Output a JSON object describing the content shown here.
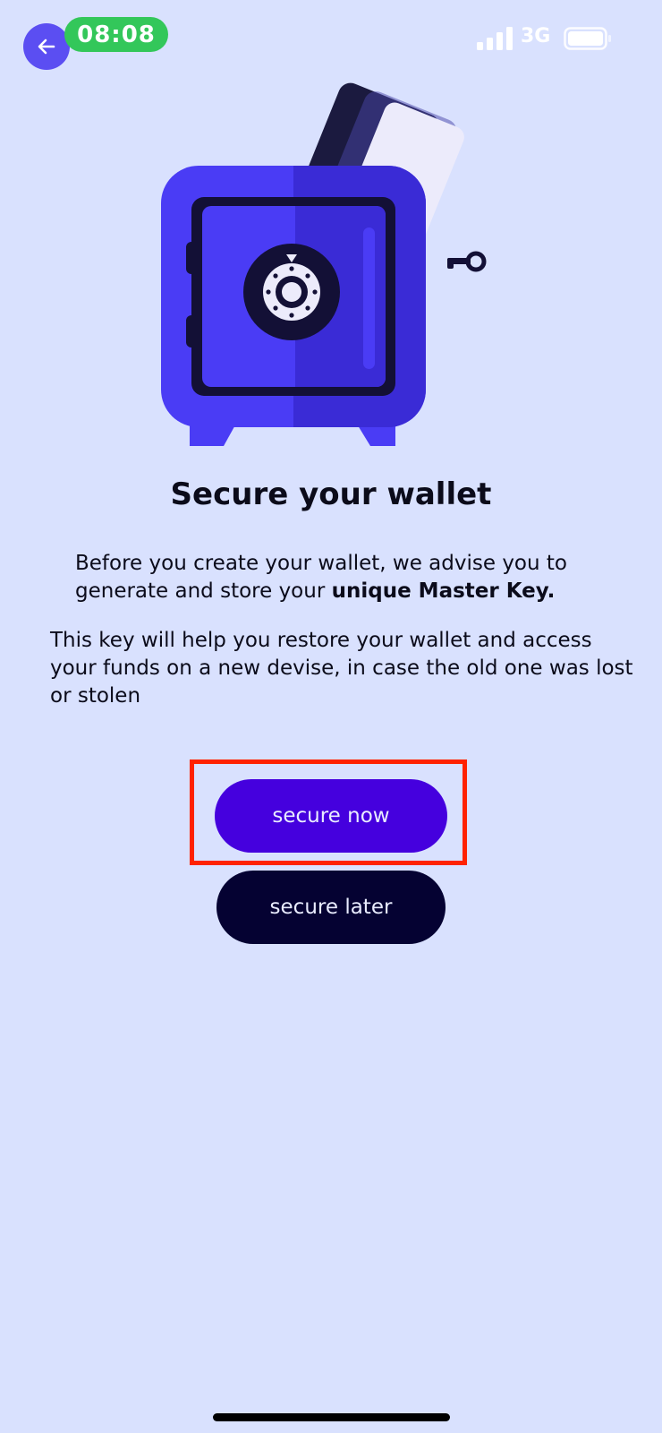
{
  "status_bar": {
    "time": "08:08",
    "network": "3G"
  },
  "main": {
    "title": "Secure your wallet",
    "intro_text": "Before you create your wallet, we advise you to generate and store your ",
    "intro_emphasis": "unique Master Key.",
    "body_text": "This key will help you restore your wallet and access your funds on a new devise, in case the old one was lost or stolen"
  },
  "actions": {
    "secure_now_label": "secure now",
    "secure_later_label": "secure later"
  },
  "colors": {
    "background": "#d9e1fe",
    "primary_button": "#4500de",
    "secondary_button": "#050232",
    "back_button": "#5b4ef2",
    "time_pill": "#33c75a",
    "highlight": "#ff2200"
  },
  "icons": {
    "back": "arrow-left-icon",
    "signal": "signal-bars-icon",
    "battery": "battery-icon",
    "illustration": "safe-with-card-icon",
    "key": "key-icon"
  }
}
